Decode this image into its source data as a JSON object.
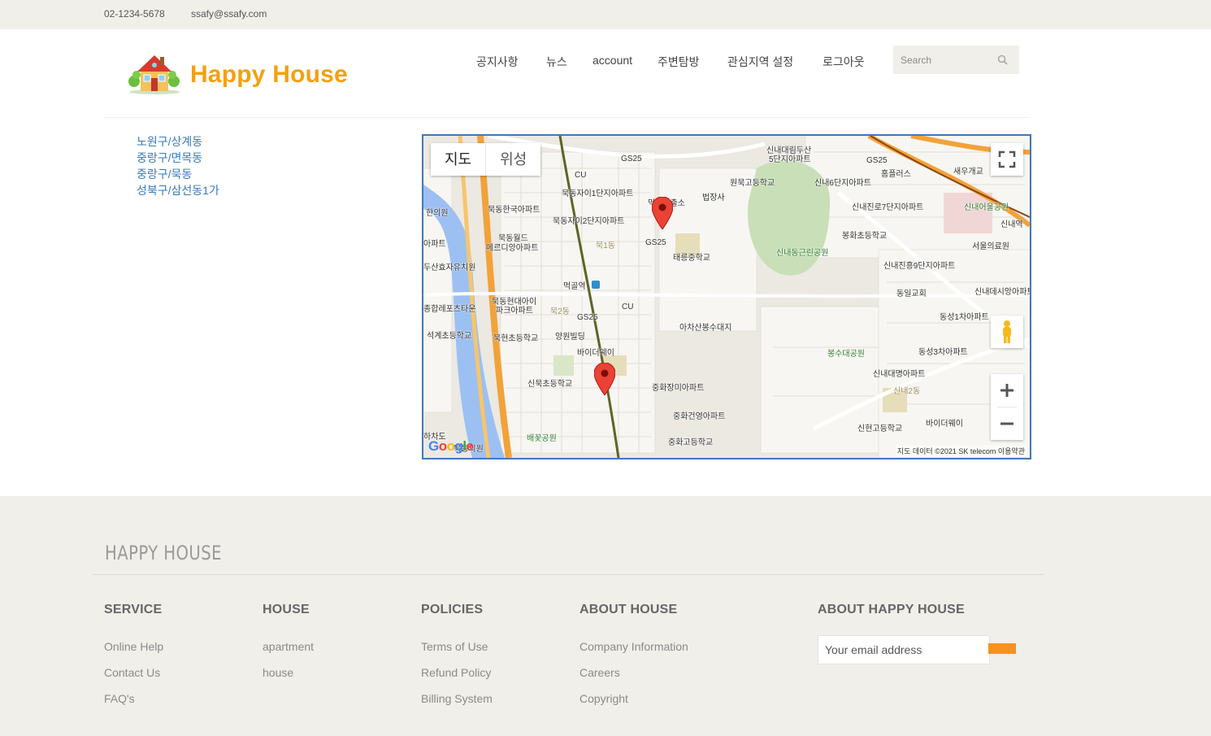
{
  "topbar": {
    "phone": "02-1234-5678",
    "email": "ssafy@ssafy.com"
  },
  "header": {
    "logo_text": "Happy House",
    "nav": [
      "공지사항",
      "뉴스",
      "account",
      "주변탐방",
      "관심지역 설정",
      "로그아웃"
    ],
    "search_placeholder": "Search"
  },
  "regions": [
    "노원구/상계동",
    "중랑구/면목동",
    "중랑구/묵동",
    "성북구/삼선동1가"
  ],
  "map": {
    "type_buttons": [
      "지도",
      "위성"
    ],
    "attribution": "지도 데이터 ©2021 SK telecom    이용약관",
    "labels": {
      "l1": "신내대림두산",
      "l2": "5단지아파트",
      "l3": "CU",
      "l4": "GS25",
      "l5": "원묵고등학교",
      "l6": "신내6단지아파트",
      "l7": "GS25",
      "l8": "홈플러스",
      "l9": "새우개교",
      "l10": "묵동자이1단지아파트",
      "l11": "법장사",
      "l12": "신내진로7단지아파트",
      "l13": "신내어울공원",
      "l14": "묵동한국아파트",
      "l15": "묵동자이2단지아파트",
      "l16": "신내역",
      "l17": "봉화초등학교",
      "l18": "서울의료원",
      "l19": "묵동월드",
      "l20": "메르디앙아파트",
      "l21": "GS25",
      "l22": "묵1동",
      "l23": "태릉중학교",
      "l24": "신내동근린공원",
      "l25": "신내진흥9단지아파트",
      "l26": "두산효자유치원",
      "l27": "먹골역",
      "l28": "동일교회",
      "l29": "신내데시앙아파트",
      "l30": "묵동현대아이",
      "l31": "파크아파트",
      "l32": "묵2동",
      "l33": "CU",
      "l34": "GS25",
      "l35": "동성1차아파트",
      "l36": "아차산봉수대지",
      "l37": "석계초등학교",
      "l38": "묵현초등학교",
      "l39": "양원빌딩",
      "l40": "바이더웨이",
      "l41": "봉수대공원",
      "l42": "동성3차아파트",
      "l43": "신묵초등학교",
      "l44": "신내대명아파트",
      "l45": "중화장미아파트",
      "l46": "신내2동",
      "l47": "중화건영아파트",
      "l48": "신현고등학교",
      "l49": "바이더웨이",
      "l50": "중화고등학교",
      "l51": "배꽃공원",
      "l52": "하차도",
      "l53": "묵동의원",
      "l54": "아파트",
      "l55": "종합레포츠타운",
      "l56": "한의원",
      "l57": "먹골파출소"
    }
  },
  "footer": {
    "brand": "HAPPY HOUSE",
    "columns": [
      {
        "title": "SERVICE",
        "links": [
          "Online Help",
          "Contact Us",
          "FAQ's"
        ]
      },
      {
        "title": "HOUSE",
        "links": [
          "apartment",
          "house"
        ]
      },
      {
        "title": "POLICIES",
        "links": [
          "Terms of Use",
          "Refund Policy",
          "Billing System"
        ]
      },
      {
        "title": "ABOUT HOUSE",
        "links": [
          "Company Information",
          "Careers",
          "Copyright"
        ]
      }
    ],
    "newsletter_title": "ABOUT HAPPY HOUSE",
    "email_placeholder": "Your email address"
  },
  "colors": {
    "brand": "#f5a00f",
    "link": "#3a7ab8",
    "accent_button": "#f6921e",
    "map_border": "#3d79c4"
  }
}
